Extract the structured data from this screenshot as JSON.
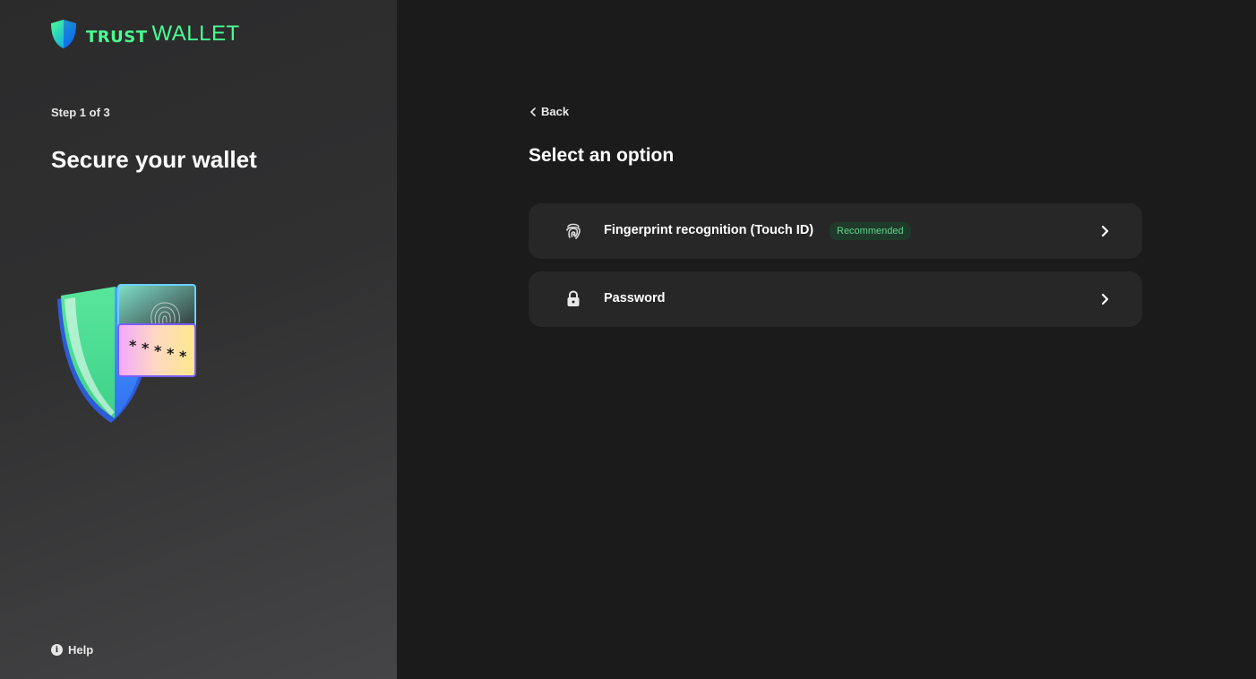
{
  "brand": {
    "name_bold": "Trust",
    "name_light": "WALLET",
    "accent_color": "#48ff91",
    "logo_icon": "shield-logo-icon"
  },
  "left": {
    "step": "Step 1 of 3",
    "title": "Secure your wallet",
    "illustration": "shield-password-illustration",
    "help_label": "Help",
    "help_icon": "info-icon"
  },
  "right": {
    "back_label": "Back",
    "back_icon": "chevron-left-icon",
    "title": "Select an option",
    "options": [
      {
        "label": "Fingerprint recognition (Touch ID)",
        "badge": "Recommended",
        "icon": "fingerprint-icon",
        "trailing_icon": "chevron-right-icon"
      },
      {
        "label": "Password",
        "icon": "lock-icon",
        "trailing_icon": "chevron-right-icon"
      }
    ]
  },
  "colors": {
    "left_panel": "#2e2e2f",
    "right_panel": "#1b1b1c",
    "option_card": "#272728",
    "badge_bg": "#1f3a2a",
    "badge_text": "#5fd48d"
  }
}
